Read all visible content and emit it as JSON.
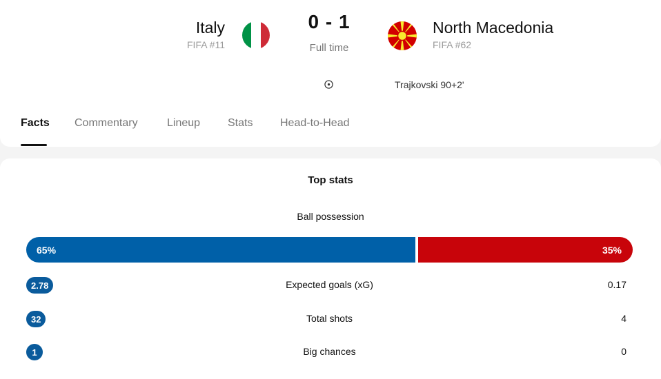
{
  "match": {
    "home": {
      "name": "Italy",
      "rank": "FIFA #11"
    },
    "away": {
      "name": "North Macedonia",
      "rank": "FIFA #62"
    },
    "score": "0 - 1",
    "status": "Full time",
    "goals": [
      {
        "icon": "football-icon",
        "scorer": "Trajkovski 90+2'"
      }
    ]
  },
  "tabs": [
    {
      "label": "Facts",
      "active": true
    },
    {
      "label": "Commentary"
    },
    {
      "label": "Lineup"
    },
    {
      "label": "Stats"
    },
    {
      "label": "Head-to-Head"
    }
  ],
  "top_stats": {
    "title": "Top stats",
    "possession": {
      "label": "Ball possession",
      "home": "65%",
      "away": "35%",
      "home_pct": 65,
      "away_pct": 35
    },
    "rows": [
      {
        "label": "Expected goals (xG)",
        "home": "2.78",
        "away": "0.17"
      },
      {
        "label": "Total shots",
        "home": "32",
        "away": "4"
      },
      {
        "label": "Big chances",
        "home": "1",
        "away": "0"
      }
    ]
  },
  "colors": {
    "home_accent": "#0060a8",
    "away_accent": "#c8040a",
    "home_pill": "#0a5b9c",
    "italy_flag": [
      "#009246",
      "#ffffff",
      "#ce2b37"
    ],
    "macedonia_flag": {
      "field": "#d20000",
      "sun": "#f8e92e"
    }
  }
}
